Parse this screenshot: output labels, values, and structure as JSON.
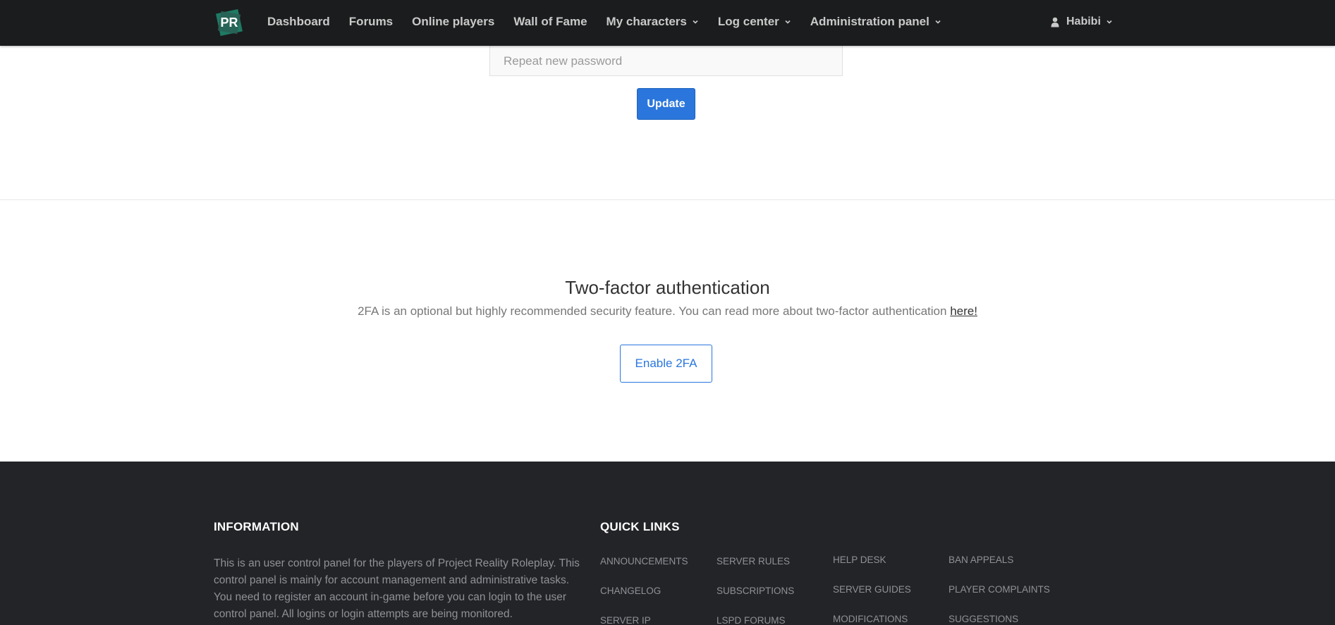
{
  "nav": {
    "logo_text": "PR",
    "items": [
      {
        "label": "Dashboard",
        "dropdown": false
      },
      {
        "label": "Forums",
        "dropdown": false
      },
      {
        "label": "Online players",
        "dropdown": false
      },
      {
        "label": "Wall of Fame",
        "dropdown": false
      },
      {
        "label": "My characters",
        "dropdown": true
      },
      {
        "label": "Log center",
        "dropdown": true
      },
      {
        "label": "Administration panel",
        "dropdown": true
      }
    ],
    "user": {
      "name": "Habibi",
      "icon": "user-icon"
    }
  },
  "password_form": {
    "repeat_placeholder": "Repeat new password",
    "update_label": "Update"
  },
  "two_factor": {
    "title": "Two-factor authentication",
    "description": "2FA is an optional but highly recommended security feature. You can read more about two-factor authentication ",
    "link_text": "here!",
    "enable_label": "Enable 2FA"
  },
  "footer": {
    "information": {
      "heading": "INFORMATION",
      "text": "This is an user control panel for the players of Project Reality Roleplay. This control panel is mainly for account management and administrative tasks. You need to register an account in-game before you can login to the user control panel. All logins or login attempts are being monitored."
    },
    "quick_links": {
      "heading": "QUICK LINKS",
      "columns": [
        [
          "ANNOUNCEMENTS",
          "CHANGELOG",
          "SERVER IP"
        ],
        [
          "SERVER RULES",
          "SUBSCRIPTIONS",
          "LSPD FORUMS"
        ],
        [
          "HELP DESK",
          "SERVER GUIDES",
          "MODIFICATIONS"
        ],
        [
          "BAN APPEALS",
          "PLAYER COMPLAINTS",
          "SUGGESTIONS"
        ]
      ]
    }
  },
  "colors": {
    "navbar_bg": "#1b1c1d",
    "accent_blue": "#2a76dc",
    "footer_bg": "#232428",
    "logo_green": "#1e7a64"
  }
}
